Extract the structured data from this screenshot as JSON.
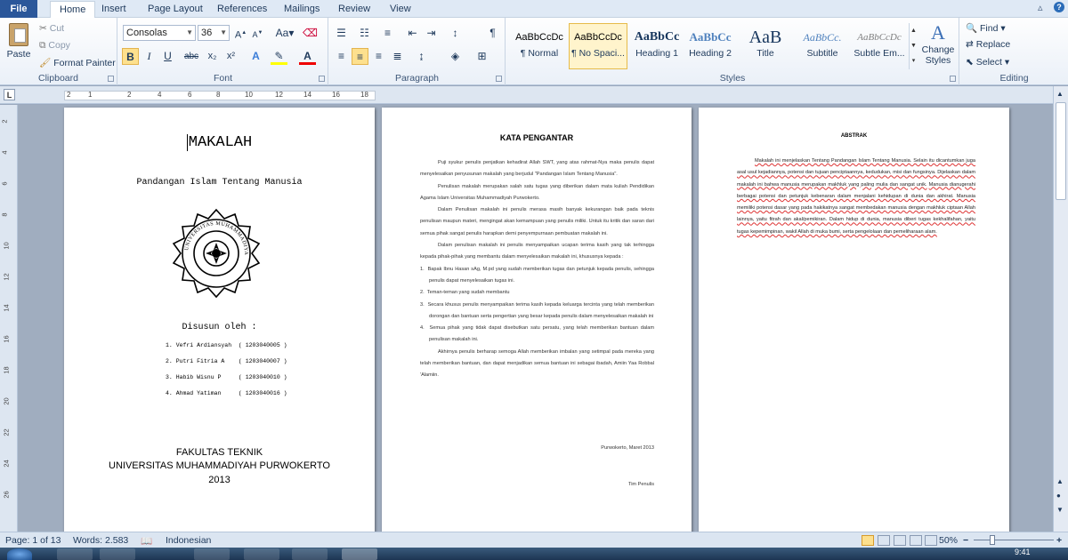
{
  "tabs": {
    "file": "File",
    "items": [
      "Home",
      "Insert",
      "Page Layout",
      "References",
      "Mailings",
      "Review",
      "View"
    ]
  },
  "clipboard": {
    "paste": "Paste",
    "cut": "Cut",
    "copy": "Copy",
    "format_painter": "Format Painter",
    "label": "Clipboard"
  },
  "font": {
    "family": "Consolas",
    "size": "36",
    "label": "Font",
    "bold": "B",
    "italic": "I",
    "underline": "U",
    "strike": "abc",
    "sub": "x₂",
    "sup": "x²",
    "grow": "A",
    "shrink": "A",
    "case": "Aa"
  },
  "paragraph": {
    "label": "Paragraph",
    "pilcrow": "¶"
  },
  "styles": {
    "label": "Styles",
    "items": [
      {
        "preview": "AaBbCcDc",
        "name": "¶ Normal"
      },
      {
        "preview": "AaBbCcDc",
        "name": "¶ No Spaci..."
      },
      {
        "preview": "AaBbCc",
        "name": "Heading 1"
      },
      {
        "preview": "AaBbCc",
        "name": "Heading 2"
      },
      {
        "preview": "AaB",
        "name": "Title"
      },
      {
        "preview": "AaBbCc.",
        "name": "Subtitle"
      },
      {
        "preview": "AaBbCcDc",
        "name": "Subtle Em..."
      }
    ],
    "change_styles": "Change Styles"
  },
  "editing": {
    "label": "Editing",
    "find": "Find",
    "replace": "Replace",
    "select": "Select"
  },
  "ruler": {
    "marks": [
      "2",
      "1",
      "2",
      "4",
      "6",
      "8",
      "10",
      "12",
      "14",
      "16",
      "18"
    ],
    "vmarks": [
      "2",
      "4",
      "6",
      "8",
      "10",
      "12",
      "14",
      "16",
      "18",
      "20",
      "22",
      "24",
      "26"
    ],
    "tab_marker": "L"
  },
  "page1": {
    "title": "MAKALAH",
    "subtitle": "Pandangan Islam Tentang Manusia",
    "logo_text": "UNIVERSITAS MUHAMMADIYAH PURWOKERTO",
    "by": "Disusun oleh :",
    "authors": [
      "1. Vefri Ardiansyah  ( 1203040005 )",
      "2. Putri Fitria A    ( 1203040007 )",
      "3. Habib Wisnu P     ( 1203040010 )",
      "4. Ahmad Yatiman     ( 1203040016 )"
    ],
    "faculty": "FAKULTAS TEKNIK",
    "university": "UNIVERSITAS MUHAMMADIYAH PURWOKERTO",
    "year": "2013"
  },
  "page2": {
    "heading": "KATA PENGANTAR",
    "paragraphs": [
      "Puji syukur penulis penjatkan kehadirat Allah SWT, yang atas rahmat-Nya maka penulis dapat menyelesaikan penyusunan makalah yang berjudul \"Pandangan Islam Tentang Manusia\".",
      "Penulisan makalah merupakan salah satu tugas yang diberikan dalam mata kuliah Pendidikan Agama Islam Universitas Muhammadiyah Purwokerto.",
      "Dalam Penulisan makalah ini penulis merasa masih banyak kekurangan baik pada teknis penulisan maupun materi, mengingat akan kemampuan yang penulis miliki. Untuk itu kritik dan saran dari semua pihak sangat penulis harapkan demi penyempurnaan pembuatan makalah ini.",
      "Dalam penulisan makalah ini penulis menyampaikan ucapan terima kasih yang tak terhingga kepada pihak-pihak yang membantu dalam menyelesaikan makalah ini, khususnya kepada :"
    ],
    "list": [
      "Bapak Ibnu Hasan sAg, M.pd yang sudah memberikan tugas dan petunjuk kepada penulis, sehingga penulis dapat menyelesaikan tugas ini.",
      "Teman-teman yang sudah membantu",
      "Secara khusus penulis menyampaikan terima kasih kepada keluarga tercinta yang telah memberikan dorongan dan bantuan serta pengertian yang besar kepada penulis dalam menyelesaikan makalah ini",
      "Semua pihak yang tidak dapat disebutkan satu persatu, yang telah memberikan bantuan dalam penulisan makalah ini."
    ],
    "closing": "Akhirnya penulis berharap semoga Allah memberikan imbalan yang setimpal pada mereka yang telah memberikan bantuan, dan dapat menjadikan semua bantuan ini sebagai ibadah, Amiin Yaa Robbal 'Alamiin.",
    "place_date": "Purwokerto, Maret 2013",
    "signature": "Tim Penulis"
  },
  "page3": {
    "heading": "ABSTRAK",
    "text_a": "Makalah ini menjelaskan Tentang Pandangan Islam Tentang Manusia. Selain itu dicantumkan juga asal usul kejadiannya, potensi dan tujuan penciptaannya, kedudukan, misi dan fungsinya. Dijelaskan dalam makalah ini bahwa manusia merupakan makhluk yang paling mulia dan sangat unik.",
    "text_b": "Manusia dianugerahi berbagai potensi dan petunjuk kebenaran dalam menjalani kehidupan di dunia dan akhirat. Manusia memiliki potensi dasar yang pada hakikatnya sangat membedakan manusia dengan makhluk ciptaan Allah lainnya, yaitu fitrah dan akal/pemikiran. Dalam hidup di dunia, manusia diberi tugas kekhalifahan, yaitu tugas kepemimpinan, wakil Allah di muka bumi, serta pengelolaan dan pemeliharaan alam."
  },
  "status": {
    "page": "Page: 1 of 13",
    "words": "Words: 2.583",
    "language": "Indonesian",
    "zoom": "50%"
  },
  "taskbar": {
    "clock": "9:41"
  },
  "colors": {
    "file_tab": "#2b579a",
    "ribbon": "#eaf0f8",
    "canvas": "#a0adbf",
    "highlight": "#fde08e"
  }
}
